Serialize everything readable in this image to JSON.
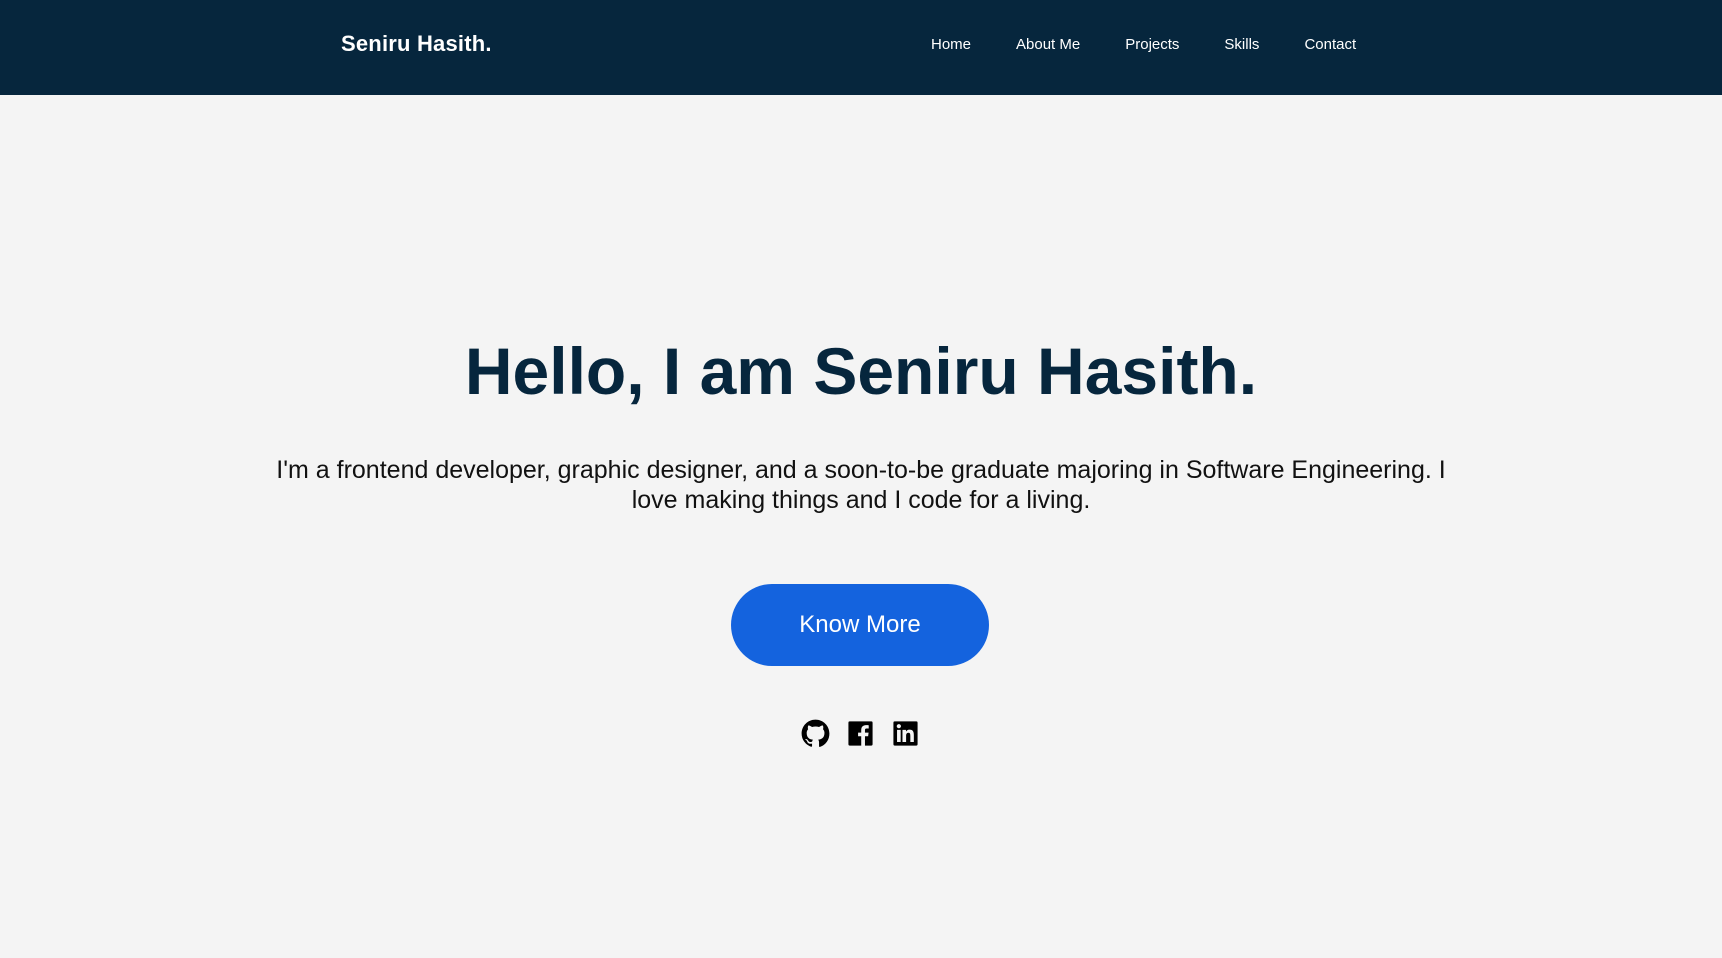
{
  "header": {
    "brand": "Seniru Hasith.",
    "nav": [
      {
        "label": "Home"
      },
      {
        "label": "About Me"
      },
      {
        "label": "Projects"
      },
      {
        "label": "Skills"
      },
      {
        "label": "Contact"
      }
    ]
  },
  "hero": {
    "title": "Hello, I am Seniru Hasith.",
    "description": "I'm a frontend developer, graphic designer, and a soon-to-be graduate majoring in Software Engineering. I love making things and I code for a living.",
    "cta_label": "Know More",
    "socials": [
      {
        "icon": "github-icon"
      },
      {
        "icon": "facebook-icon"
      },
      {
        "icon": "linkedin-icon"
      }
    ]
  },
  "colors": {
    "navbar_bg": "#06263d",
    "page_bg": "#f4f4f4",
    "accent": "#1463de",
    "title": "#06263d"
  }
}
